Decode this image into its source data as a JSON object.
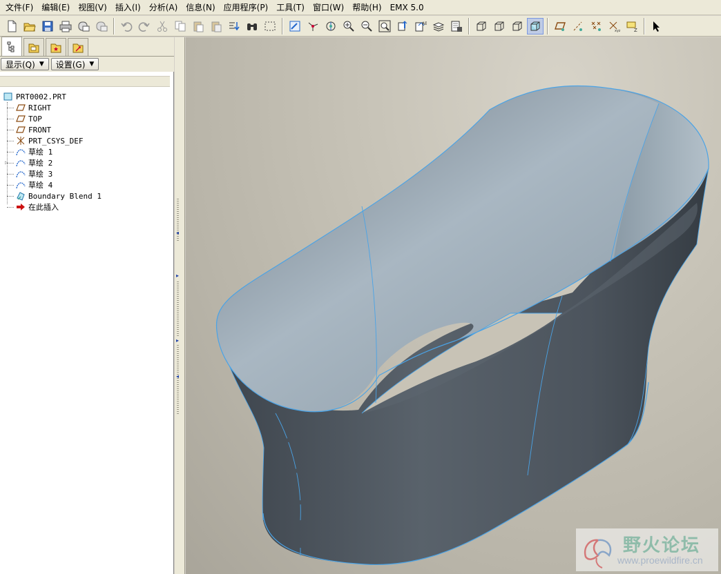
{
  "menu": [
    {
      "label": "文件(F)"
    },
    {
      "label": "编辑(E)"
    },
    {
      "label": "视图(V)"
    },
    {
      "label": "插入(I)"
    },
    {
      "label": "分析(A)"
    },
    {
      "label": "信息(N)"
    },
    {
      "label": "应用程序(P)"
    },
    {
      "label": "工具(T)"
    },
    {
      "label": "窗口(W)"
    },
    {
      "label": "帮助(H)"
    },
    {
      "label": "EMX 5.0"
    }
  ],
  "panel": {
    "show_label": "显示(Q)",
    "settings_label": "设置(G)"
  },
  "tree": {
    "root": "PRT0002.PRT",
    "items": [
      {
        "label": "RIGHT",
        "icon": "datum-plane-icon"
      },
      {
        "label": "TOP",
        "icon": "datum-plane-icon"
      },
      {
        "label": "FRONT",
        "icon": "datum-plane-icon"
      },
      {
        "label": "PRT_CSYS_DEF",
        "icon": "csys-icon"
      },
      {
        "label": "草绘 1",
        "icon": "sketch-icon"
      },
      {
        "label": "草绘 2",
        "icon": "sketch-icon"
      },
      {
        "label": "草绘 3",
        "icon": "sketch-icon"
      },
      {
        "label": "草绘 4",
        "icon": "sketch-icon"
      },
      {
        "label": "Boundary Blend 1",
        "icon": "boundary-blend-icon"
      },
      {
        "label": "在此插入",
        "icon": "insert-here-arrow-icon"
      }
    ]
  },
  "watermark": {
    "title": "野火论坛",
    "url": "www.proewildfire.cn"
  },
  "colors": {
    "edge_blue": "#4aa3e6",
    "surface_light": "#a8b6c0",
    "surface_dark": "#4a525b"
  }
}
